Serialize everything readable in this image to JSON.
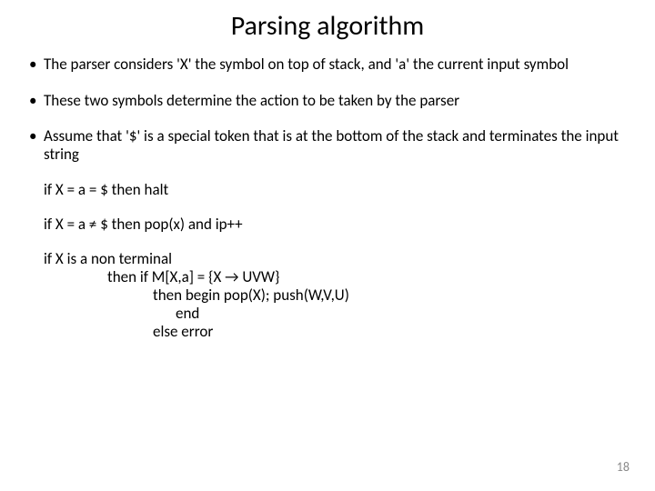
{
  "title": "Parsing algorithm",
  "bullets": [
    "The parser considers 'X' the symbol on top of stack, and 'a' the current input symbol",
    "These two symbols determine the action to be taken by the parser",
    "Assume that '$' is a special token that is at the bottom of the stack and terminates the input string"
  ],
  "code": {
    "line1": "if X = a = $ then halt",
    "line2": "if X = a ≠ $ then pop(x) and ip++",
    "line3": "if X is a non terminal",
    "line4": "then if M[X,a] = {X → UVW}",
    "line5": "then begin pop(X); push(W,V,U)",
    "line6": "end",
    "line7": "else error"
  },
  "page_number": "18"
}
